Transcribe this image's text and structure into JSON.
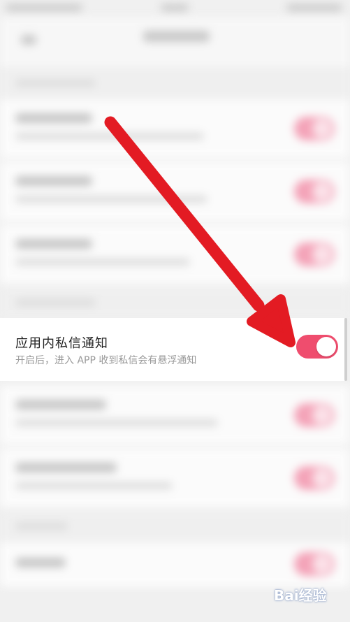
{
  "setting": {
    "title": "应用内私信通知",
    "description": "开启后，进入 APP 收到私信会有悬浮通知",
    "enabled": true
  },
  "colors": {
    "toggle_on": "#ef4d6e",
    "arrow": "#e31b23"
  },
  "watermark": {
    "text": "Bai经验",
    "icon": "baidu-paw-icon"
  }
}
